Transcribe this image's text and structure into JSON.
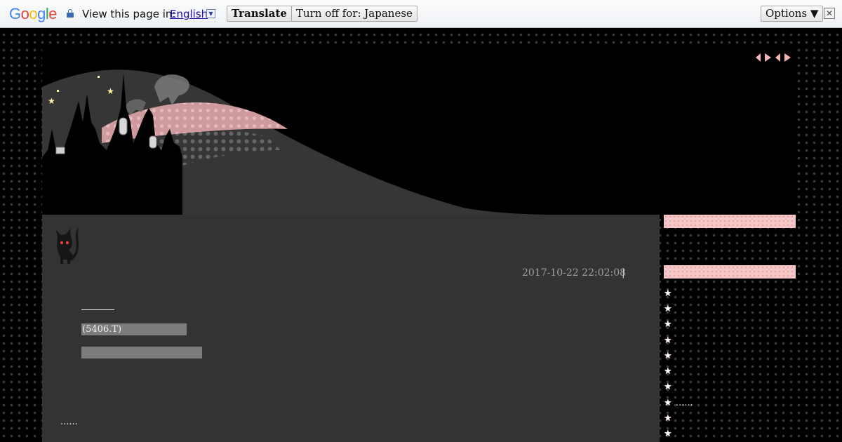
{
  "translate_bar": {
    "logo": "Google",
    "logo_letters": [
      {
        "ch": "G",
        "color": "#4285f4"
      },
      {
        "ch": "o",
        "color": "#ea4335"
      },
      {
        "ch": "o",
        "color": "#fbbc05"
      },
      {
        "ch": "g",
        "color": "#4285f4"
      },
      {
        "ch": "l",
        "color": "#34a853"
      },
      {
        "ch": "e",
        "color": "#ea4335"
      }
    ],
    "view_page_in": "View this page in:",
    "language": "English",
    "translate_label": "Translate",
    "turn_off_label": "Turn off for: Japanese",
    "options_label": "Options ▼",
    "close_symbol": "✕"
  },
  "post": {
    "datetime": "2017-10-22 22:02:08",
    "separator": "|",
    "highlight_1": "(5406.T)",
    "ellipsis": "......"
  },
  "sidebar": {
    "items": [
      "",
      "",
      "",
      "",
      "",
      "",
      "",
      "......",
      "",
      ""
    ]
  },
  "colors": {
    "accent_pink": "#f5c6c6",
    "content_bg": "#333333",
    "page_bg": "#000000"
  }
}
